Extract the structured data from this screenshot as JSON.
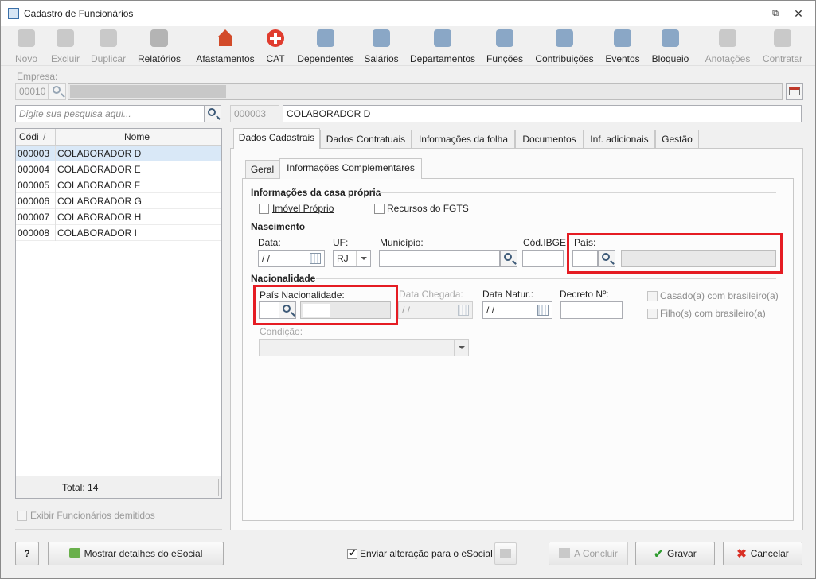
{
  "window": {
    "title": "Cadastro de Funcionários"
  },
  "toolbar": {
    "items": [
      {
        "label": "Novo",
        "icon": "new-icon",
        "enabled": false
      },
      {
        "label": "Excluir",
        "icon": "trash-icon",
        "enabled": false
      },
      {
        "label": "Duplicar",
        "icon": "duplicate-icon",
        "enabled": false
      },
      {
        "label": "Relatórios",
        "icon": "report-icon",
        "enabled": true
      },
      {
        "label": "Afastamentos",
        "icon": "house-icon",
        "enabled": true
      },
      {
        "label": "CAT",
        "icon": "medical-cross-icon",
        "enabled": true
      },
      {
        "label": "Dependentes",
        "icon": "people-icon",
        "enabled": true
      },
      {
        "label": "Salários",
        "icon": "money-icon",
        "enabled": true
      },
      {
        "label": "Departamentos",
        "icon": "desk-icon",
        "enabled": true
      },
      {
        "label": "Funções",
        "icon": "badge-icon",
        "enabled": true
      },
      {
        "label": "Contribuições",
        "icon": "contribution-icon",
        "enabled": true
      },
      {
        "label": "Eventos",
        "icon": "list-icon",
        "enabled": true
      },
      {
        "label": "Bloqueio",
        "icon": "lock-icon",
        "enabled": true
      },
      {
        "label": "Anotações",
        "icon": "note-icon",
        "enabled": false
      },
      {
        "label": "Contratar",
        "icon": "contract-icon",
        "enabled": false
      }
    ]
  },
  "empresa": {
    "label": "Empresa:",
    "code": "00010"
  },
  "search": {
    "placeholder": "Digite sua pesquisa aqui..."
  },
  "employee": {
    "code": "000003",
    "name": "COLABORADOR D"
  },
  "grid": {
    "headers": {
      "code": "Códi",
      "name": "Nome"
    },
    "sort_indicator": "/",
    "rows": [
      {
        "code": "000003",
        "name": "COLABORADOR D"
      },
      {
        "code": "000004",
        "name": "COLABORADOR E"
      },
      {
        "code": "000005",
        "name": "COLABORADOR F"
      },
      {
        "code": "000006",
        "name": "COLABORADOR G"
      },
      {
        "code": "000007",
        "name": "COLABORADOR H"
      },
      {
        "code": "000008",
        "name": "COLABORADOR I"
      }
    ],
    "total": "Total: 14"
  },
  "show_dismissed": {
    "label": "Exibir Funcionários demitidos",
    "checked": false
  },
  "tabs": [
    "Dados Cadastrais",
    "Dados Contratuais",
    "Informações da folha",
    "Documentos",
    "Inf. adicionais",
    "Gestão"
  ],
  "subtabs": [
    "Geral",
    "Informações Complementares"
  ],
  "casa_propria": {
    "title": "Informações da casa própria",
    "imovel_proprio": "Imóvel Próprio",
    "recursos_fgts": "Recursos do FGTS"
  },
  "nascimento": {
    "title": "Nascimento",
    "data_label": "Data:",
    "data_value": " / /",
    "uf_label": "UF:",
    "uf_value": "RJ",
    "municipio_label": "Município:",
    "ibge_label": "Cód.IBGE:",
    "pais_label": "País:"
  },
  "nacionalidade": {
    "title": "Nacionalidade",
    "pais_label": "País Nacionalidade:",
    "chegada_label": "Data Chegada:",
    "chegada_value": " / /",
    "natur_label": "Data Natur.:",
    "natur_value": " / /",
    "decreto_label": "Decreto Nº:",
    "casado_label": "Casado(a) com brasileiro(a)",
    "filho_label": "Filho(s) com brasileiro(a)",
    "condicao_label": "Condição:"
  },
  "footer": {
    "help": "?",
    "esocial_details": "Mostrar detalhes do eSocial",
    "send_change": "Enviar alteração para o eSocial",
    "concluir": "A Concluir",
    "gravar": "Gravar",
    "cancelar": "Cancelar"
  },
  "colors": {
    "highlight": "#e51c23",
    "selection": "#d9e8f7"
  }
}
